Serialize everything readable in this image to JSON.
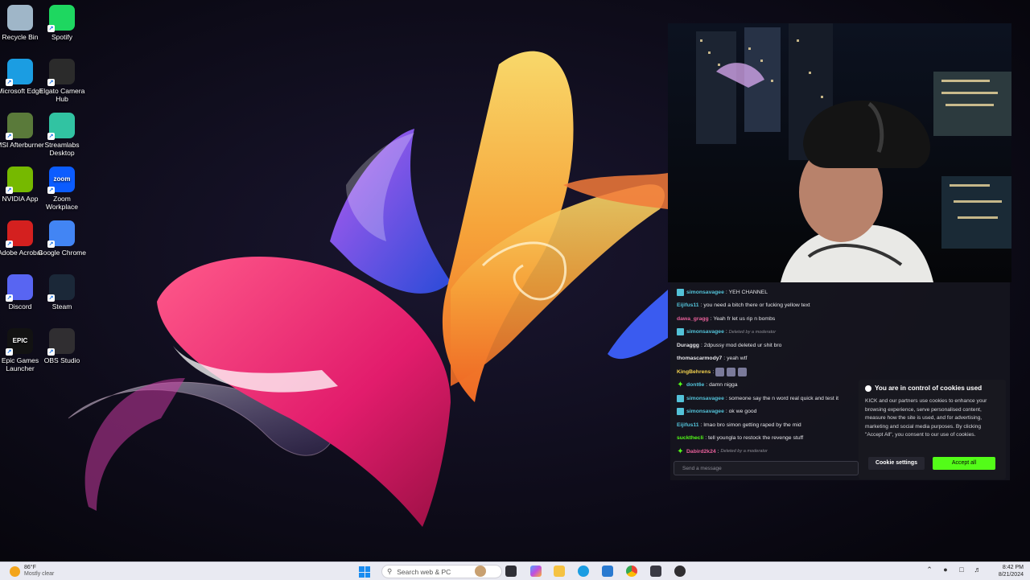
{
  "desktop": {
    "icons": [
      {
        "label": "Recycle Bin",
        "icon": "recycle-bin-icon",
        "color": "#9fb6c8"
      },
      {
        "label": "Spotify",
        "icon": "spotify-icon",
        "color": "#1ed760"
      },
      {
        "label": "Microsoft Edge",
        "icon": "edge-icon",
        "color": "#1b9de2"
      },
      {
        "label": "Elgato Camera Hub",
        "icon": "elgato-icon",
        "color": "#2b2b2b"
      },
      {
        "label": "MSI Afterburner",
        "icon": "msi-afterburner-icon",
        "color": "#5a7a3a"
      },
      {
        "label": "Streamlabs Desktop",
        "icon": "streamlabs-icon",
        "color": "#31c3a2"
      },
      {
        "label": "NVIDIA App",
        "icon": "nvidia-icon",
        "color": "#76b900"
      },
      {
        "label": "Zoom Workplace",
        "icon": "zoom-icon",
        "color": "#0b5cff",
        "glyph": "zoom"
      },
      {
        "label": "Adobe Acrobat",
        "icon": "adobe-acrobat-icon",
        "color": "#d4201f"
      },
      {
        "label": "Google Chrome",
        "icon": "chrome-icon",
        "color": "#4285f4"
      },
      {
        "label": "Discord",
        "icon": "discord-icon",
        "color": "#5865f2"
      },
      {
        "label": "Steam",
        "icon": "steam-icon",
        "color": "#1b2838"
      },
      {
        "label": "Epic Games Launcher",
        "icon": "epic-games-icon",
        "color": "#121212",
        "glyph": "EPIC"
      },
      {
        "label": "OBS Studio",
        "icon": "obs-icon",
        "color": "#302e31"
      }
    ]
  },
  "chat": {
    "messages": [
      {
        "badge": "mod",
        "user": "simonsavagee",
        "color": "#53c2d8",
        "text": "YEH CHANNEL"
      },
      {
        "badge": "",
        "user": "Eijifus11",
        "color": "#53c2d8",
        "text": "you need a bitch there or fucking yellow text"
      },
      {
        "badge": "",
        "user": "dawa_gragg",
        "color": "#e8609a",
        "text": "Yeah fr let us rip n bombs"
      },
      {
        "badge": "mod",
        "user": "simonsavagee",
        "color": "#53c2d8",
        "deleted": "Deleted by a moderator"
      },
      {
        "badge": "",
        "user": "Duraggg",
        "color": "#e6e6ea",
        "text": "2dpussy mod deleted ur shit bro"
      },
      {
        "badge": "",
        "user": "thomascarmody7",
        "color": "#e6e6ea",
        "text": "yeah wtf"
      },
      {
        "badge": "",
        "user": "KingBehrens",
        "color": "#f4d34f",
        "emotes": 3
      },
      {
        "badge": "vip",
        "user": "dont6e",
        "color": "#53c2d8",
        "text": "damn nigga"
      },
      {
        "badge": "mod",
        "user": "simonsavagee",
        "color": "#53c2d8",
        "text": "someone say the n word real quick and test it"
      },
      {
        "badge": "mod",
        "user": "simonsavagee",
        "color": "#53c2d8",
        "text": "ok we good"
      },
      {
        "badge": "",
        "user": "Eijifus11",
        "color": "#53c2d8",
        "text": "lmao bro simon getting raped by the mid"
      },
      {
        "badge": "",
        "user": "suckthecli",
        "color": "#53fc18",
        "text": "tell youngla to restock the revenge stuff"
      },
      {
        "badge": "vip",
        "user": "Dabird2k24",
        "color": "#e8609a",
        "deleted": "Deleted by a moderator"
      }
    ],
    "input_placeholder": "Send a message"
  },
  "cookie_banner": {
    "title": "You are in control of cookies used",
    "body": "KICK and our partners use cookies to enhance your browsing experience, serve personalised content, measure how the site is used, and for advertising, marketing and social media purposes. By clicking \"Accept All\", you consent to our use of cookies.",
    "settings_label": "Cookie settings",
    "accept_label": "Accept all"
  },
  "taskbar": {
    "weather_temp": "86°F",
    "weather_desc": "Mostly clear",
    "search_placeholder": "Search web & PC",
    "time": "8:42 PM",
    "date": "8/21/2024"
  },
  "colors": {
    "kick_green": "#53fc18",
    "taskbar_bg": "#e9eaf2"
  }
}
